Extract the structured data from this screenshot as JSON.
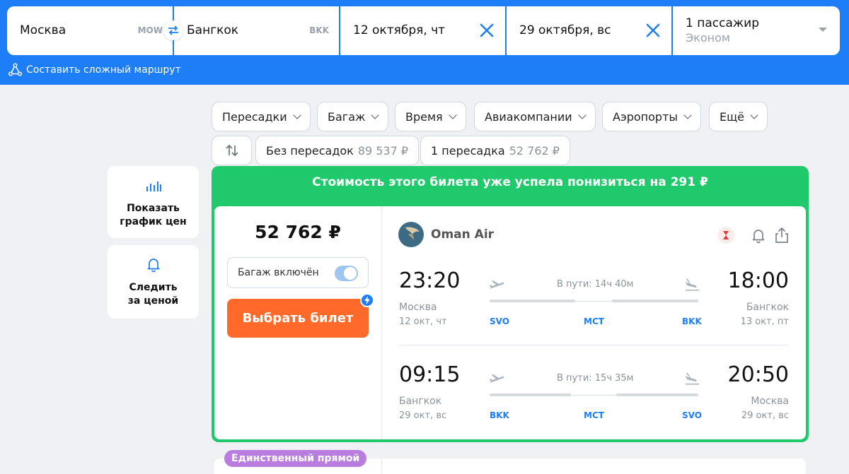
{
  "search": {
    "from_city": "Москва",
    "from_code": "MOW",
    "to_city": "Бангкок",
    "to_code": "BKK",
    "depart_date": "12 октября, чт",
    "return_date": "29 октября, вс",
    "passengers": "1 пассажир",
    "cabin": "Эконом",
    "complex_route": "Составить сложный маршрут"
  },
  "filters": {
    "transfers": "Пересадки",
    "baggage": "Багаж",
    "time": "Время",
    "airlines": "Авиакомпании",
    "airports": "Аэропорты",
    "more": "Ещё",
    "nonstop_label": "Без пересадок",
    "nonstop_price": "89 537 ₽",
    "one_stop_label": "1 пересадка",
    "one_stop_price": "52 762 ₽"
  },
  "side": {
    "chart_label_1": "Показать",
    "chart_label_2": "график цен",
    "track_label_1": "Следить",
    "track_label_2": "за ценой"
  },
  "ticket": {
    "banner": "Стоимость этого билета уже успела понизиться на 291 ₽",
    "price": "52 762 ₽",
    "baggage_label": "Багаж включён",
    "baggage_included": true,
    "buy_button": "Выбрать билет",
    "airline": "Oman Air",
    "outbound": {
      "dep_time": "23:20",
      "dep_city": "Москва",
      "dep_date": "12 окт, чт",
      "duration": "В пути: 14ч 40м",
      "from_code": "SVO",
      "via_code": "MCT",
      "to_code": "BKK",
      "arr_time": "18:00",
      "arr_city": "Бангкок",
      "arr_date": "13 окт, пт"
    },
    "return": {
      "dep_time": "09:15",
      "dep_city": "Бангкок",
      "dep_date": "29 окт, вс",
      "duration": "В пути: 15ч 35м",
      "from_code": "BKK",
      "via_code": "MCT",
      "to_code": "SVO",
      "arr_time": "20:50",
      "arr_city": "Москва",
      "arr_date": "29 окт, вс"
    }
  },
  "next_badge": "Единственный прямой",
  "colors": {
    "brand_blue": "#1e7ef7",
    "success_green": "#20c96b",
    "buy_orange": "#ff6a2b",
    "badge_purple": "#b97de0"
  }
}
